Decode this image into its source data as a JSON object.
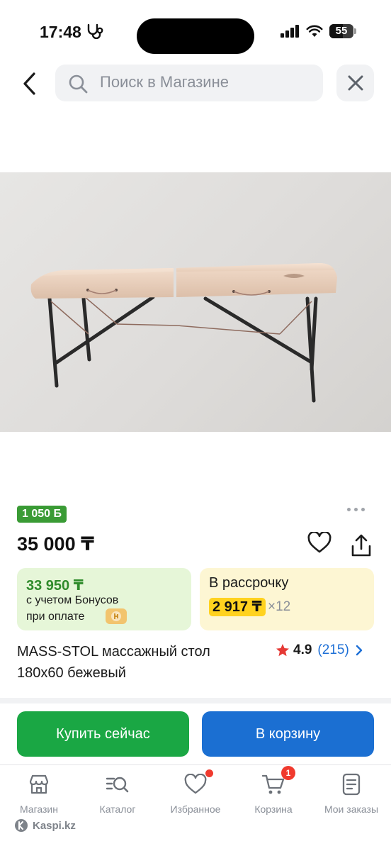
{
  "status_bar": {
    "time": "17:48",
    "battery": "55",
    "battery_level": 0.55,
    "icons": [
      "stethoscope-icon",
      "cellular-signal-icon",
      "wifi-icon",
      "battery-icon"
    ]
  },
  "header": {
    "back_icon": "chevron-left-icon",
    "search_placeholder": "Поиск в Магазине",
    "search_icon": "search-icon",
    "close_icon": "close-icon"
  },
  "product": {
    "image_subject": "beige folding massage table",
    "bonus_badge": "1 050 Б",
    "price": "35 000 ₸",
    "bonus_card": {
      "amount": "33 950 ₸",
      "line1": "с учетом Бонусов",
      "line2": "при оплате"
    },
    "installment": {
      "title": "В рассрочку",
      "monthly": "2 917 ₸",
      "term": "×12"
    },
    "title": "MASS-STOL массажный стол 180х60 бежевый",
    "rating": {
      "value": "4.9",
      "count": "(215)"
    }
  },
  "actions": {
    "buy_now": "Купить сейчас",
    "add_to_cart": "В корзину"
  },
  "tab_bar": {
    "tabs": [
      {
        "label": "Магазин",
        "icon": "shop-icon"
      },
      {
        "label": "Каталог",
        "icon": "catalog-search-icon"
      },
      {
        "label": "Избранное",
        "icon": "heart-icon"
      },
      {
        "label": "Корзина",
        "icon": "cart-icon",
        "badge": "1"
      },
      {
        "label": "Мои заказы",
        "icon": "orders-icon"
      }
    ]
  },
  "watermark": "Kaspi.kz",
  "colors": {
    "bonus_green": "#3a9b35",
    "buy_button": "#1aa744",
    "cart_button": "#1b6fd2",
    "installment_highlight": "#ffd21f",
    "badge_red": "#f03a2e",
    "link_blue": "#1d6fd6"
  }
}
